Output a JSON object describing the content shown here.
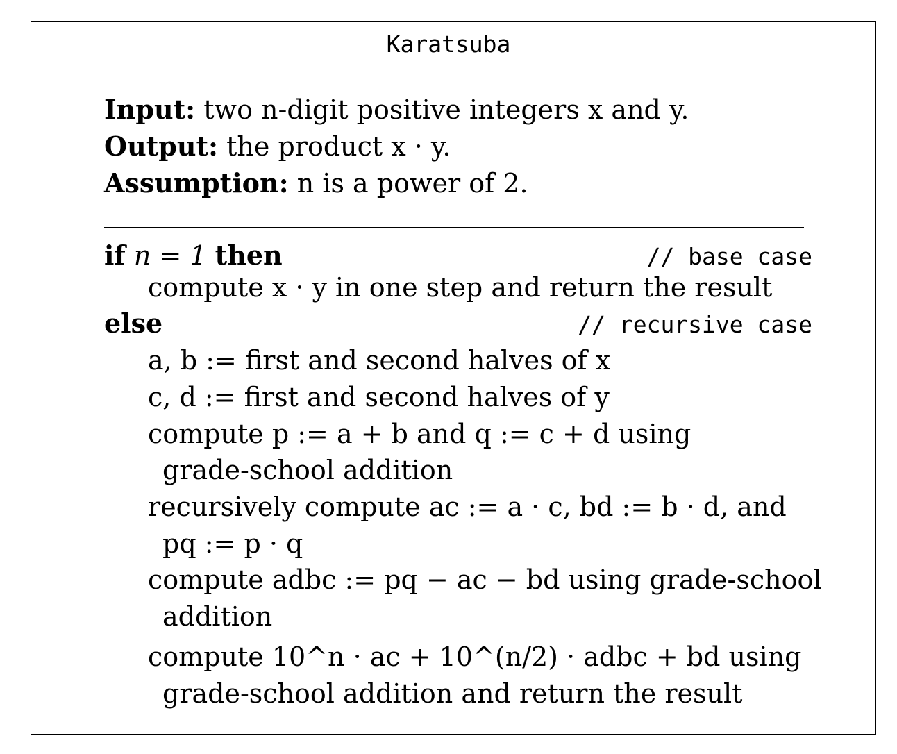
{
  "algorithm": {
    "title": "Karatsuba",
    "spec": {
      "input_label": "Input:",
      "input_text": "two n-digit positive integers x and y.",
      "output_label": "Output:",
      "output_text": "the product x · y.",
      "assumption_label": "Assumption:",
      "assumption_text": "n is a power of 2."
    },
    "body": {
      "if_keyword": "if",
      "if_condition": "n = 1",
      "then_keyword": "then",
      "base_comment": "// base case",
      "base_step": "compute x · y in one step and return the result",
      "else_keyword": "else",
      "recursive_comment": "// recursive case",
      "steps": [
        "a, b := first and second halves of x",
        "c, d := first and second halves of y",
        "compute p := a + b and q := c + d using",
        "grade-school addition",
        "recursively compute ac := a · c, bd := b · d, and",
        "pq := p · q",
        "compute adbc := pq − ac − bd using grade-school",
        "addition",
        "compute 10^n · ac + 10^(n/2) · adbc + bd using",
        "grade-school addition and return the result"
      ]
    }
  }
}
